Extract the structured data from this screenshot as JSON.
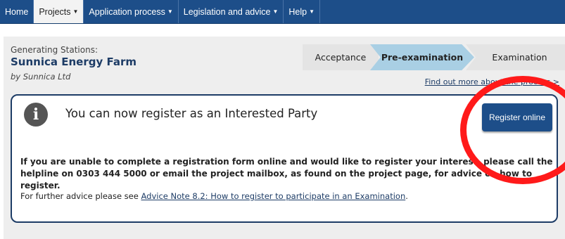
{
  "nav": {
    "items": [
      {
        "label": "Home",
        "has_caret": false
      },
      {
        "label": "Projects",
        "has_caret": true
      },
      {
        "label": "Application process",
        "has_caret": true
      },
      {
        "label": "Legislation and advice",
        "has_caret": true
      },
      {
        "label": "Help",
        "has_caret": true
      }
    ],
    "caret_glyph": "▼"
  },
  "project": {
    "category": "Generating Stations:",
    "title": "Sunnica Energy Farm",
    "byline": "by Sunnica Ltd"
  },
  "process": {
    "steps": [
      "Acceptance",
      "Pre-examination",
      "Examination"
    ],
    "current_step": "Pre-examination",
    "link": "Find out more about the process >"
  },
  "notice": {
    "icon": "info-icon",
    "heading": "You can now register as an Interested Party",
    "register_button": "Register online",
    "bold_text": "If you are unable to complete a registration form online and would like to register your interest, please call the helpline on 0303 444 5000 or email the project mailbox, as found on the project page, for advice on how to register.",
    "further_prefix": "For further advice please see ",
    "further_link": "Advice Note 8.2: How to register to participate in an Examination",
    "further_suffix": "."
  },
  "colors": {
    "nav_bg": "#1d4e89",
    "title": "#1d3c66",
    "active_step": "#a9cfe4",
    "annotation": "#ff1a1a"
  }
}
